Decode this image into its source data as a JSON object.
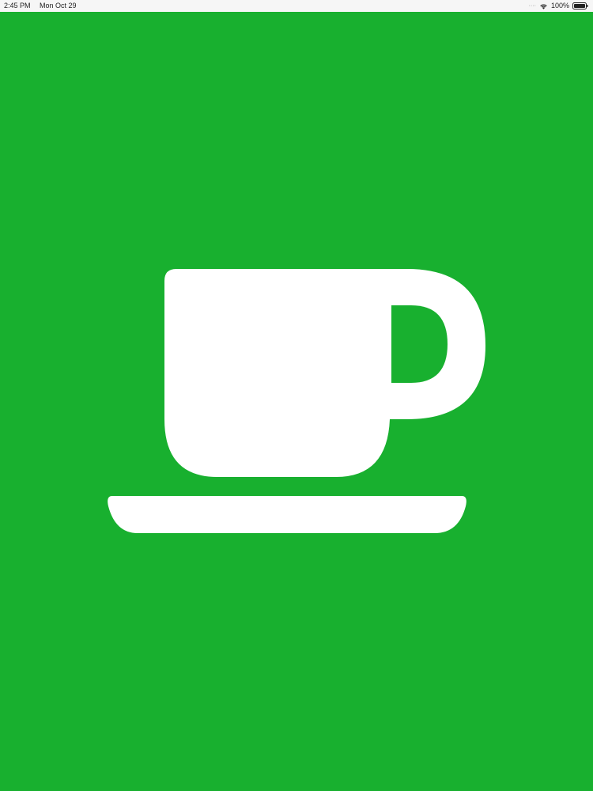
{
  "status_bar": {
    "time": "2:45 PM",
    "date": "Mon Oct 29",
    "signal": "····",
    "battery": "100%"
  },
  "splash": {
    "background": "#18b02f",
    "icon": "coffee-cup-icon",
    "icon_color": "#ffffff"
  }
}
